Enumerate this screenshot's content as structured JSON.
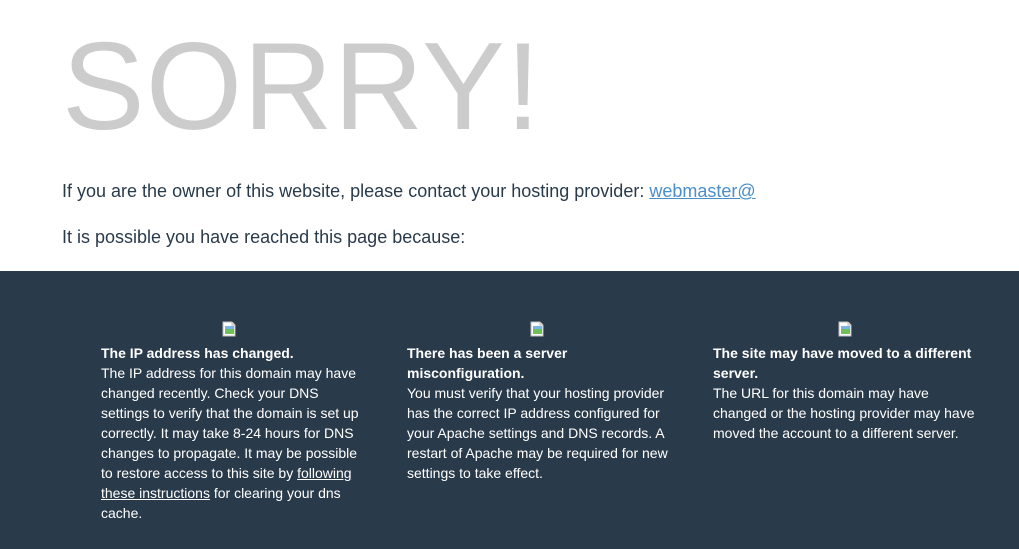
{
  "header": {
    "title": "SORRY!"
  },
  "intro": {
    "owner_text": "If you are the owner of this website, please contact your hosting provider: ",
    "contact_link": "webmaster@",
    "reason_text": "It is possible you have reached this page because:"
  },
  "reasons": [
    {
      "icon": "broken-image-icon",
      "title": "The IP address has changed.",
      "text_before": "The IP address for this domain may have changed recently. Check your DNS settings to verify that the domain is set up correctly. It may take 8-24 hours for DNS changes to propagate. It may be possible to restore access to this site by ",
      "link": "following these instructions",
      "text_after": " for clearing your dns cache."
    },
    {
      "icon": "broken-image-icon",
      "title": "There has been a server misconfiguration.",
      "text": "You must verify that your hosting provider has the correct IP address configured for your Apache settings and DNS records. A restart of Apache may be required for new settings to take effect."
    },
    {
      "icon": "broken-image-icon",
      "title": "The site may have moved to a different server.",
      "text": "The URL for this domain may have changed or the hosting provider may have moved the account to a different server."
    }
  ],
  "colors": {
    "heading": "#cccccc",
    "body_text": "#293a4a",
    "link": "#4b8ec8",
    "footer_bg": "#293a4a"
  }
}
